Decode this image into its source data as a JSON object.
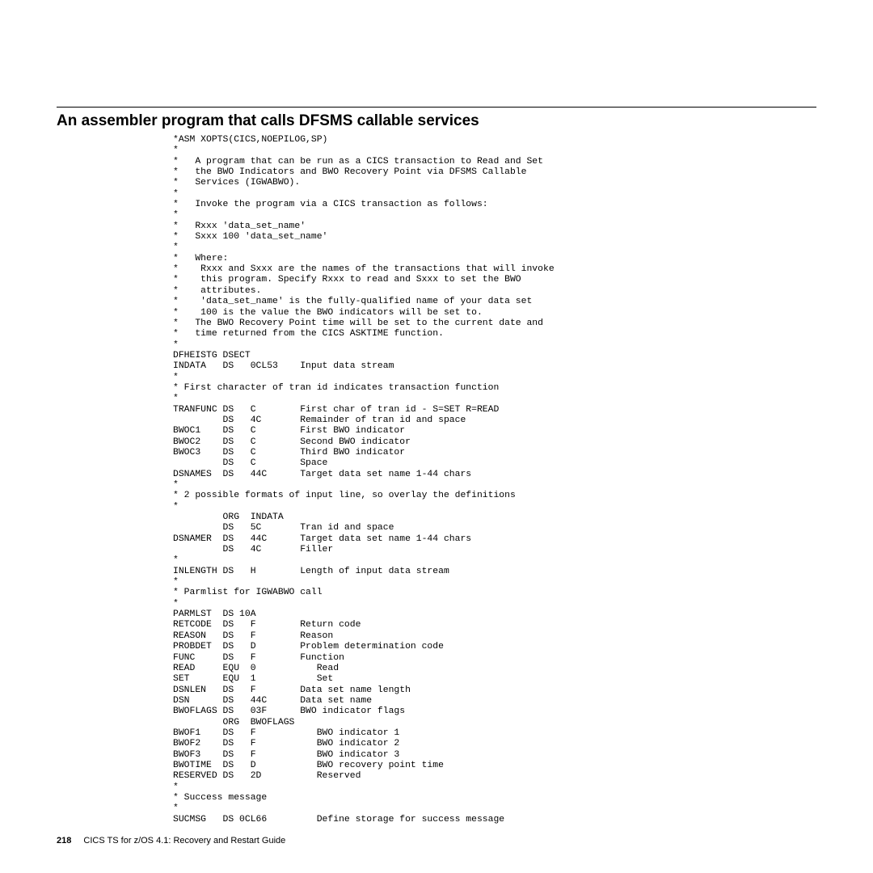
{
  "heading": "An assembler program that calls DFSMS callable services",
  "code": "*ASM XOPTS(CICS,NOEPILOG,SP)\n*\n*   A program that can be run as a CICS transaction to Read and Set\n*   the BWO Indicators and BWO Recovery Point via DFSMS Callable\n*   Services (IGWABWO).\n*\n*   Invoke the program via a CICS transaction as follows:\n*\n*   Rxxx 'data_set_name'\n*   Sxxx 100 'data_set_name'\n*\n*   Where:\n*    Rxxx and Sxxx are the names of the transactions that will invoke\n*    this program. Specify Rxxx to read and Sxxx to set the BWO\n*    attributes.\n*    'data_set_name' is the fully-qualified name of your data set\n*    100 is the value the BWO indicators will be set to.\n*   The BWO Recovery Point time will be set to the current date and\n*   time returned from the CICS ASKTIME function.\n*\nDFHEISTG DSECT\nINDATA   DS   0CL53    Input data stream\n*\n* First character of tran id indicates transaction function\n*\nTRANFUNC DS   C        First char of tran id - S=SET R=READ\n         DS   4C       Remainder of tran id and space\nBWOC1    DS   C        First BWO indicator\nBWOC2    DS   C        Second BWO indicator\nBWOC3    DS   C        Third BWO indicator\n         DS   C        Space\nDSNAMES  DS   44C      Target data set name 1-44 chars\n*\n* 2 possible formats of input line, so overlay the definitions\n*\n         ORG  INDATA\n         DS   5C       Tran id and space\nDSNAMER  DS   44C      Target data set name 1-44 chars\n         DS   4C       Filler\n*\nINLENGTH DS   H        Length of input data stream\n*\n* Parmlist for IGWABWO call\n*\nPARMLST  DS 10A\nRETCODE  DS   F        Return code\nREASON   DS   F        Reason\nPROBDET  DS   D        Problem determination code\nFUNC     DS   F        Function\nREAD     EQU  0           Read\nSET      EQU  1           Set\nDSNLEN   DS   F        Data set name length\nDSN      DS   44C      Data set name\nBWOFLAGS DS   03F      BWO indicator flags\n         ORG  BWOFLAGS\nBWOF1    DS   F           BWO indicator 1\nBWOF2    DS   F           BWO indicator 2\nBWOF3    DS   F           BWO indicator 3\nBWOTIME  DS   D           BWO recovery point time\nRESERVED DS   2D          Reserved\n*\n* Success message\n*\nSUCMSG   DS 0CL66         Define storage for success message",
  "footer": {
    "page_number": "218",
    "book_title": "CICS TS for z/OS 4.1: Recovery and Restart Guide"
  }
}
